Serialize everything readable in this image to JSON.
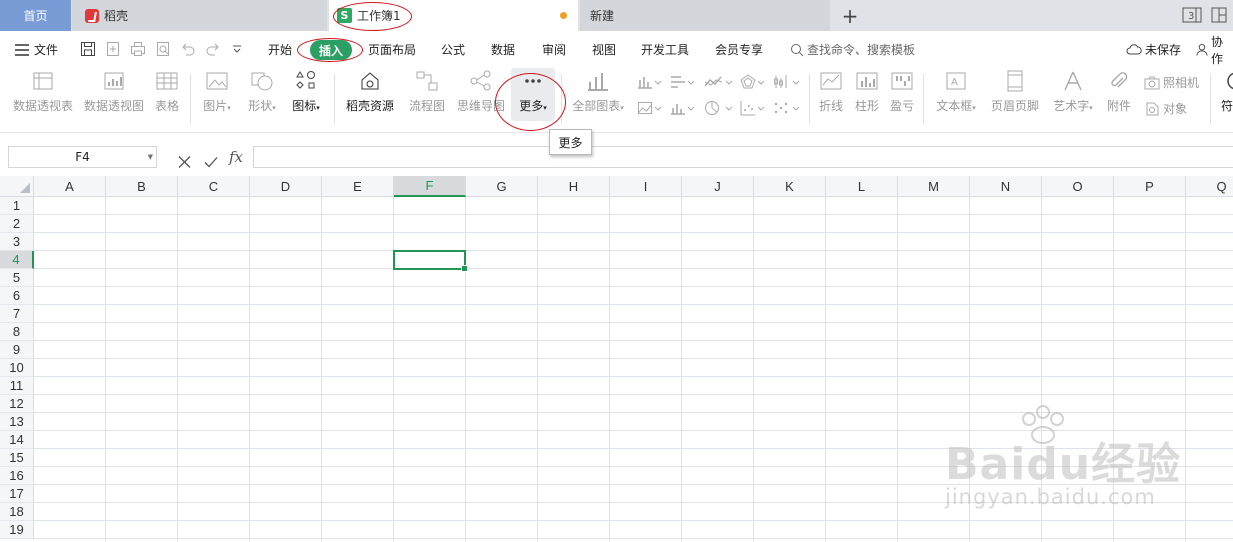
{
  "tabs": {
    "home": "首页",
    "daoke": "稻壳",
    "workbook": "工作簿1",
    "new": "新建",
    "add": "+"
  },
  "menu": {
    "file": "文件",
    "items": [
      "开始",
      "插入",
      "页面布局",
      "公式",
      "数据",
      "审阅",
      "视图",
      "开发工具",
      "会员专享"
    ],
    "search": "查找命令、搜索模板",
    "unsaved": "未保存",
    "collab": "协作"
  },
  "ribbon": {
    "pivot_table": "数据透视表",
    "pivot_chart": "数据透视图",
    "table": "表格",
    "picture": "图片",
    "shape": "形状",
    "icon": "图标",
    "daoke_res": "稻壳资源",
    "flowchart": "流程图",
    "mindmap": "思维导图",
    "more": "更多",
    "all_charts": "全部图表",
    "line": "折线",
    "column": "柱形",
    "winloss": "盈亏",
    "textbox": "文本框",
    "header_footer": "页眉页脚",
    "wordart": "艺术字",
    "attachment": "附件",
    "camera": "照相机",
    "object": "对象",
    "symbol": "符"
  },
  "tooltip": "更多",
  "formula_bar": {
    "cell_ref": "F4",
    "fx": "fx",
    "value": ""
  },
  "grid": {
    "columns": [
      "A",
      "B",
      "C",
      "D",
      "E",
      "F",
      "G",
      "H",
      "I",
      "J",
      "K",
      "L",
      "M",
      "N",
      "O",
      "P",
      "Q"
    ],
    "rows": [
      "1",
      "2",
      "3",
      "4",
      "5",
      "6",
      "7",
      "8",
      "9",
      "10",
      "11",
      "12",
      "13",
      "14",
      "15",
      "16",
      "17",
      "18",
      "19"
    ],
    "selected_column": "F",
    "selected_row": "4"
  },
  "watermark": {
    "main": "Baidu经验",
    "sub": "jingyan.baidu.com"
  },
  "colors": {
    "accent": "#2b9e63",
    "annotation": "#d0151c",
    "home_tab": "#7a9cd6"
  }
}
